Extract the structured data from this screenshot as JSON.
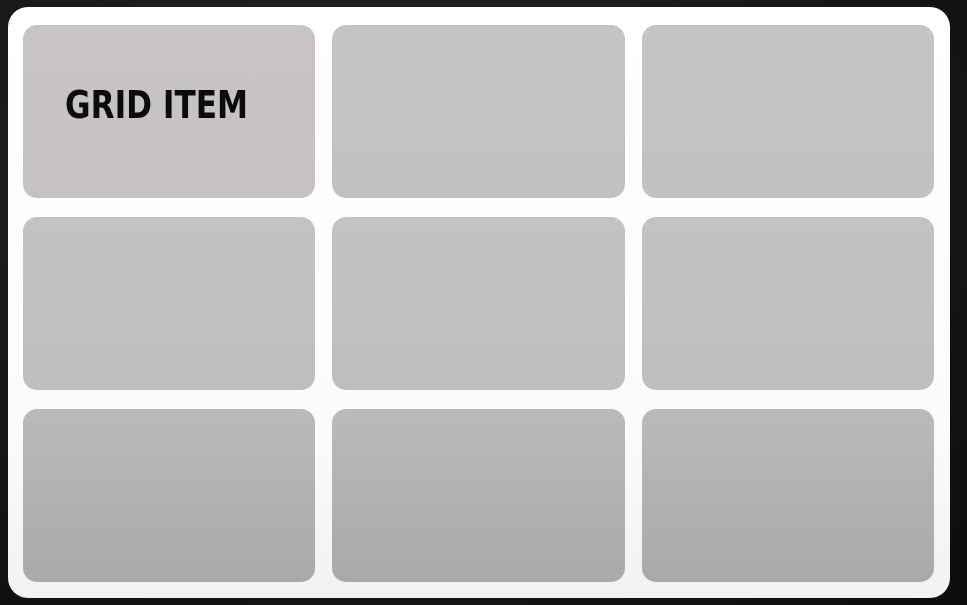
{
  "grid": {
    "rows": 3,
    "columns": 3,
    "items": [
      {
        "label": "GRID ITEM"
      },
      {
        "label": ""
      },
      {
        "label": ""
      },
      {
        "label": ""
      },
      {
        "label": ""
      },
      {
        "label": ""
      },
      {
        "label": ""
      },
      {
        "label": ""
      },
      {
        "label": ""
      }
    ]
  },
  "colors": {
    "background": "#161616",
    "container": "#ffffff",
    "item": "#c2c2c2",
    "label": "#0b0b0b"
  }
}
